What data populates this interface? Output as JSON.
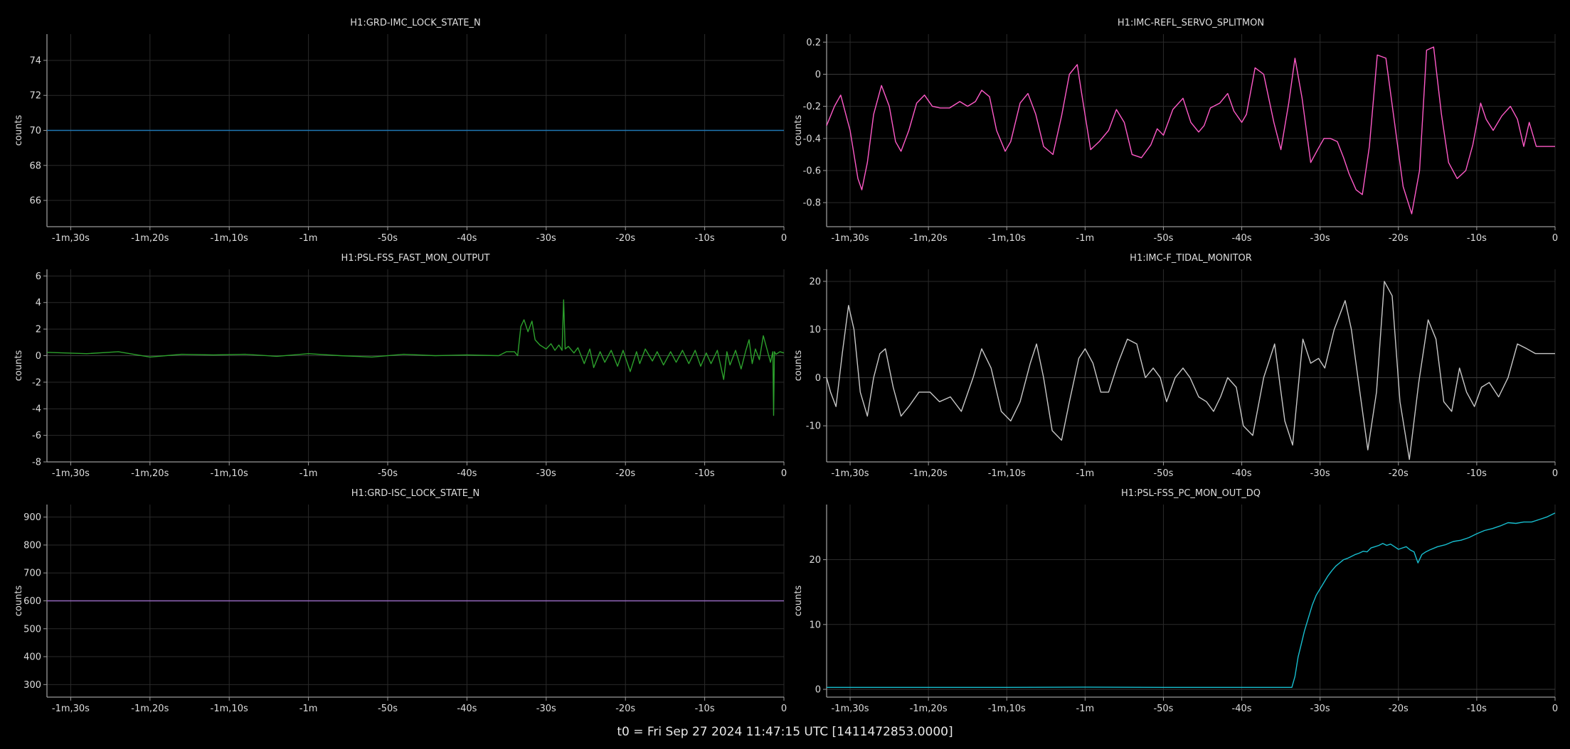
{
  "footer": "t0 = Fri Sep 27 2024 11:47:15 UTC [1411472853.0000]",
  "chart_data": [
    {
      "type": "line",
      "title": "H1:GRD-IMC_LOCK_STATE_N",
      "ylabel": "counts",
      "xlim": [
        -93,
        0
      ],
      "ylim": [
        64.5,
        75.5
      ],
      "x_ticks": [
        -90,
        -80,
        -70,
        -60,
        -50,
        -40,
        -30,
        -20,
        -10,
        0
      ],
      "x_tick_labels": [
        "-1m,30s",
        "-1m,20s",
        "-1m,10s",
        "-1m",
        "-50s",
        "-40s",
        "-30s",
        "-20s",
        "-10s",
        "0"
      ],
      "y_ticks": [
        66,
        68,
        70,
        72,
        74
      ],
      "y_tick_labels": [
        "66",
        "68",
        "70",
        "72",
        "74"
      ],
      "grid": true,
      "series": [
        {
          "color": "#1f77b4",
          "x": [
            -93,
            0
          ],
          "y": [
            70,
            70
          ]
        }
      ]
    },
    {
      "type": "line",
      "title": "H1:IMC-REFL_SERVO_SPLITMON",
      "ylabel": "counts",
      "xlim": [
        -93,
        0
      ],
      "ylim": [
        -0.95,
        0.25
      ],
      "x_ticks": [
        -90,
        -80,
        -70,
        -60,
        -50,
        -40,
        -30,
        -20,
        -10,
        0
      ],
      "x_tick_labels": [
        "-1m,30s",
        "-1m,20s",
        "-1m,10s",
        "-1m",
        "-50s",
        "-40s",
        "-30s",
        "-20s",
        "-10s",
        "0"
      ],
      "y_ticks": [
        -0.8,
        -0.6,
        -0.4,
        -0.2,
        0,
        0.2
      ],
      "y_tick_labels": [
        "-0.8",
        "-0.6",
        "-0.4",
        "-0.2",
        "0",
        "0.2"
      ],
      "grid": true,
      "series": [
        {
          "color": "#ff5ac8",
          "x": [
            -93,
            -92,
            -91.2,
            -90,
            -89,
            -88.5,
            -87.8,
            -87,
            -86,
            -85,
            -84.2,
            -83.5,
            -82.5,
            -81.5,
            -80.5,
            -79.5,
            -78.5,
            -77.3,
            -76,
            -75,
            -74,
            -73.2,
            -72.2,
            -71.3,
            -70.2,
            -69.5,
            -68.3,
            -67.3,
            -66.3,
            -65.3,
            -64.1,
            -63,
            -62,
            -61,
            -60.5,
            -59.3,
            -58.2,
            -57,
            -56,
            -55,
            -54,
            -52.8,
            -51.6,
            -50.8,
            -50,
            -48.8,
            -47.5,
            -46.5,
            -45.5,
            -44.8,
            -44,
            -42.8,
            -41.8,
            -41,
            -40,
            -39.4,
            -38.3,
            -37.2,
            -35.9,
            -35,
            -34,
            -33.2,
            -32.3,
            -31.2,
            -30.2,
            -29.5,
            -28.7,
            -27.8,
            -27,
            -26.3,
            -25.4,
            -24.6,
            -23.7,
            -22.7,
            -21.6,
            -20.5,
            -19.4,
            -18.3,
            -17.3,
            -16.4,
            -15.5,
            -14.5,
            -13.6,
            -12.5,
            -11.4,
            -10.5,
            -9.5,
            -8.8,
            -7.9,
            -6.8,
            -5.7,
            -4.8,
            -4,
            -3.3,
            -2.4,
            -1.5,
            -0.7,
            0
          ],
          "y": [
            -0.32,
            -0.2,
            -0.13,
            -0.35,
            -0.65,
            -0.72,
            -0.55,
            -0.25,
            -0.07,
            -0.2,
            -0.42,
            -0.48,
            -0.35,
            -0.18,
            -0.13,
            -0.2,
            -0.21,
            -0.21,
            -0.17,
            -0.2,
            -0.17,
            -0.1,
            -0.14,
            -0.35,
            -0.48,
            -0.42,
            -0.18,
            -0.12,
            -0.25,
            -0.45,
            -0.5,
            -0.26,
            0.0,
            0.06,
            -0.1,
            -0.47,
            -0.42,
            -0.35,
            -0.22,
            -0.3,
            -0.5,
            -0.52,
            -0.44,
            -0.34,
            -0.38,
            -0.22,
            -0.15,
            -0.3,
            -0.36,
            -0.32,
            -0.21,
            -0.18,
            -0.12,
            -0.23,
            -0.3,
            -0.25,
            0.04,
            0.0,
            -0.3,
            -0.47,
            -0.18,
            0.1,
            -0.15,
            -0.55,
            -0.46,
            -0.4,
            -0.4,
            -0.42,
            -0.52,
            -0.62,
            -0.72,
            -0.75,
            -0.45,
            0.12,
            0.1,
            -0.3,
            -0.7,
            -0.87,
            -0.6,
            0.15,
            0.17,
            -0.25,
            -0.55,
            -0.65,
            -0.6,
            -0.44,
            -0.18,
            -0.28,
            -0.35,
            -0.26,
            -0.2,
            -0.28,
            -0.45,
            -0.3,
            -0.45,
            -0.45,
            -0.45,
            -0.45
          ]
        }
      ]
    },
    {
      "type": "line",
      "title": "H1:PSL-FSS_FAST_MON_OUTPUT",
      "ylabel": "counts",
      "xlim": [
        -93,
        0
      ],
      "ylim": [
        -8,
        6.5
      ],
      "x_ticks": [
        -90,
        -80,
        -70,
        -60,
        -50,
        -40,
        -30,
        -20,
        -10,
        0
      ],
      "x_tick_labels": [
        "-1m,30s",
        "-1m,20s",
        "-1m,10s",
        "-1m",
        "-50s",
        "-40s",
        "-30s",
        "-20s",
        "-10s",
        "0"
      ],
      "y_ticks": [
        -8,
        -6,
        -4,
        -2,
        0,
        2,
        4,
        6
      ],
      "y_tick_labels": [
        "-8",
        "-6",
        "-4",
        "-2",
        "0",
        "2",
        "4",
        "6"
      ],
      "grid": true,
      "series": [
        {
          "color": "#2ca02c",
          "x": [
            -93,
            -88,
            -84,
            -80,
            -76,
            -72,
            -68,
            -64,
            -60,
            -56,
            -52,
            -48,
            -44,
            -40,
            -36,
            -35,
            -34,
            -33.6,
            -33.2,
            -32.8,
            -32.3,
            -31.8,
            -31.4,
            -30.8,
            -30,
            -29.4,
            -28.9,
            -28.4,
            -28.0,
            -27.8,
            -27.6,
            -27.2,
            -26.5,
            -26,
            -25.2,
            -24.5,
            -24.0,
            -23.2,
            -22.6,
            -21.8,
            -21,
            -20.3,
            -19.4,
            -18.6,
            -18.2,
            -17.5,
            -16.6,
            -16,
            -15.2,
            -14.3,
            -13.6,
            -12.8,
            -12,
            -11.2,
            -10.5,
            -9.8,
            -9.2,
            -8.4,
            -7.6,
            -7.2,
            -6.8,
            -6.1,
            -5.4,
            -4.8,
            -4.4,
            -4.0,
            -3.6,
            -3.1,
            -2.6,
            -2.1,
            -1.7,
            -1.4,
            -1.3,
            -1.2,
            -1.0,
            -0.5,
            0
          ],
          "y": [
            0.25,
            0.15,
            0.3,
            -0.1,
            0.1,
            0.05,
            0.1,
            -0.05,
            0.15,
            0.0,
            -0.1,
            0.1,
            0.0,
            0.05,
            0.0,
            0.3,
            0.3,
            0.0,
            2.2,
            2.7,
            1.8,
            2.6,
            1.2,
            0.8,
            0.5,
            0.9,
            0.4,
            0.8,
            0.4,
            4.2,
            0.5,
            0.7,
            0.2,
            0.6,
            -0.6,
            0.5,
            -0.9,
            0.3,
            -0.5,
            0.4,
            -0.8,
            0.4,
            -1.2,
            0.3,
            -0.6,
            0.5,
            -0.4,
            0.3,
            -0.7,
            0.3,
            -0.5,
            0.4,
            -0.6,
            0.4,
            -0.8,
            0.2,
            -0.6,
            0.4,
            -1.8,
            0.3,
            -0.7,
            0.4,
            -1.0,
            0.4,
            1.2,
            -0.6,
            0.5,
            -0.3,
            1.5,
            0.4,
            -0.5,
            0.3,
            -4.5,
            0.3,
            0.1,
            0.3,
            0.2
          ]
        }
      ]
    },
    {
      "type": "line",
      "title": "H1:IMC-F_TIDAL_MONITOR",
      "ylabel": "counts",
      "xlim": [
        -93,
        0
      ],
      "ylim": [
        -17.5,
        22.5
      ],
      "x_ticks": [
        -90,
        -80,
        -70,
        -60,
        -50,
        -40,
        -30,
        -20,
        -10,
        0
      ],
      "x_tick_labels": [
        "-1m,30s",
        "-1m,20s",
        "-1m,10s",
        "-1m",
        "-50s",
        "-40s",
        "-30s",
        "-20s",
        "-10s",
        "0"
      ],
      "y_ticks": [
        -10,
        0,
        10,
        20
      ],
      "y_tick_labels": [
        "-10",
        "0",
        "10",
        "20"
      ],
      "grid": true,
      "series": [
        {
          "color": "#c8c8c8",
          "x": [
            -93,
            -92.5,
            -91.8,
            -91,
            -90.2,
            -89.5,
            -88.7,
            -87.8,
            -87,
            -86.2,
            -85.5,
            -84.5,
            -83.5,
            -82.5,
            -81.2,
            -79.8,
            -78.6,
            -77.2,
            -75.8,
            -74.3,
            -73.2,
            -72,
            -70.7,
            -69.5,
            -68.3,
            -67,
            -66.2,
            -65.3,
            -64.2,
            -63,
            -62,
            -60.8,
            -60,
            -59,
            -58,
            -57,
            -55.8,
            -54.6,
            -53.4,
            -52.3,
            -51.3,
            -50.4,
            -49.6,
            -48.5,
            -47.5,
            -46.6,
            -45.5,
            -44.5,
            -43.6,
            -42.7,
            -41.8,
            -40.7,
            -39.8,
            -38.6,
            -37.2,
            -35.8,
            -34.5,
            -33.5,
            -32.2,
            -31.2,
            -30.2,
            -29.4,
            -28.2,
            -26.8,
            -26,
            -25,
            -23.9,
            -22.8,
            -21.8,
            -20.8,
            -19.8,
            -18.6,
            -17.4,
            -16.2,
            -15.2,
            -14.2,
            -13.2,
            -12.2,
            -11.3,
            -10.3,
            -9.4,
            -8.4,
            -7.2,
            -6,
            -4.8,
            -3.6,
            -2.5,
            -1.6,
            -0.8,
            0
          ],
          "y": [
            0,
            -3,
            -6,
            5,
            15,
            10,
            -3,
            -8,
            0,
            5,
            6,
            -2,
            -8,
            -6,
            -3,
            -3,
            -5,
            -4,
            -7,
            0,
            6,
            2,
            -7,
            -9,
            -5,
            3,
            7,
            0,
            -11,
            -13,
            -5,
            4,
            6,
            3,
            -3,
            -3,
            3,
            8,
            7,
            0,
            2,
            0,
            -5,
            0,
            2,
            0,
            -4,
            -5,
            -7,
            -4,
            0,
            -2,
            -10,
            -12,
            0,
            7,
            -9,
            -14,
            8,
            3,
            4,
            2,
            10,
            16,
            10,
            -2,
            -15,
            -3,
            20,
            17,
            -5,
            -17,
            -1,
            12,
            8,
            -5,
            -7,
            2,
            -3,
            -6,
            -2,
            -1,
            -4,
            0,
            7,
            6,
            5,
            5,
            5,
            5
          ]
        }
      ]
    },
    {
      "type": "line",
      "title": "H1:GRD-ISC_LOCK_STATE_N",
      "ylabel": "counts",
      "xlim": [
        -93,
        0
      ],
      "ylim": [
        255,
        945
      ],
      "x_ticks": [
        -90,
        -80,
        -70,
        -60,
        -50,
        -40,
        -30,
        -20,
        -10,
        0
      ],
      "x_tick_labels": [
        "-1m,30s",
        "-1m,20s",
        "-1m,10s",
        "-1m",
        "-50s",
        "-40s",
        "-30s",
        "-20s",
        "-10s",
        "0"
      ],
      "y_ticks": [
        300,
        400,
        500,
        600,
        700,
        800,
        900
      ],
      "y_tick_labels": [
        "300",
        "400",
        "500",
        "600",
        "700",
        "800",
        "900"
      ],
      "grid": true,
      "series": [
        {
          "color": "#9467bd",
          "x": [
            -93,
            0
          ],
          "y": [
            600,
            600
          ]
        }
      ]
    },
    {
      "type": "line",
      "title": "H1:PSL-FSS_PC_MON_OUT_DQ",
      "ylabel": "counts",
      "xlim": [
        -93,
        0
      ],
      "ylim": [
        -1.2,
        28.5
      ],
      "x_ticks": [
        -90,
        -80,
        -70,
        -60,
        -50,
        -40,
        -30,
        -20,
        -10,
        0
      ],
      "x_tick_labels": [
        "-1m,30s",
        "-1m,20s",
        "-1m,10s",
        "-1m",
        "-50s",
        "-40s",
        "-30s",
        "-20s",
        "-10s",
        "0"
      ],
      "y_ticks": [
        0,
        10,
        20
      ],
      "y_tick_labels": [
        "0",
        "10",
        "20"
      ],
      "grid": true,
      "series": [
        {
          "color": "#17becf",
          "x": [
            -93,
            -80,
            -70,
            -60,
            -50,
            -40,
            -35,
            -33.6,
            -33.2,
            -32.8,
            -32.4,
            -32.0,
            -31.5,
            -31.0,
            -30.5,
            -30.0,
            -29.5,
            -29.0,
            -28.5,
            -28.0,
            -27.5,
            -27.0,
            -26.5,
            -26.0,
            -25.5,
            -25.0,
            -24.5,
            -24.0,
            -23.5,
            -23.0,
            -22.5,
            -22.0,
            -21.5,
            -21.0,
            -20.5,
            -20.0,
            -19.5,
            -19.0,
            -18.5,
            -18.0,
            -17.8,
            -17.5,
            -17.0,
            -16.5,
            -16.0,
            -15.0,
            -14.0,
            -13.0,
            -12.0,
            -11.0,
            -10.0,
            -9.0,
            -8.0,
            -7.0,
            -6.0,
            -5.0,
            -4.0,
            -3.0,
            -2.0,
            -1.0,
            0
          ],
          "y": [
            0.3,
            0.3,
            0.3,
            0.35,
            0.3,
            0.3,
            0.3,
            0.3,
            2,
            5,
            7,
            9,
            11,
            13,
            14.5,
            15.5,
            16.5,
            17.5,
            18.3,
            19,
            19.5,
            20,
            20.2,
            20.5,
            20.8,
            21,
            21.3,
            21.2,
            21.8,
            22,
            22.2,
            22.5,
            22.2,
            22.4,
            22,
            21.6,
            21.8,
            22,
            21.5,
            21.2,
            20.5,
            19.5,
            20.8,
            21.2,
            21.5,
            22,
            22.3,
            22.8,
            23,
            23.4,
            24,
            24.5,
            24.8,
            25.2,
            25.7,
            25.6,
            25.8,
            25.8,
            26.2,
            26.6,
            27.2
          ]
        }
      ]
    }
  ]
}
